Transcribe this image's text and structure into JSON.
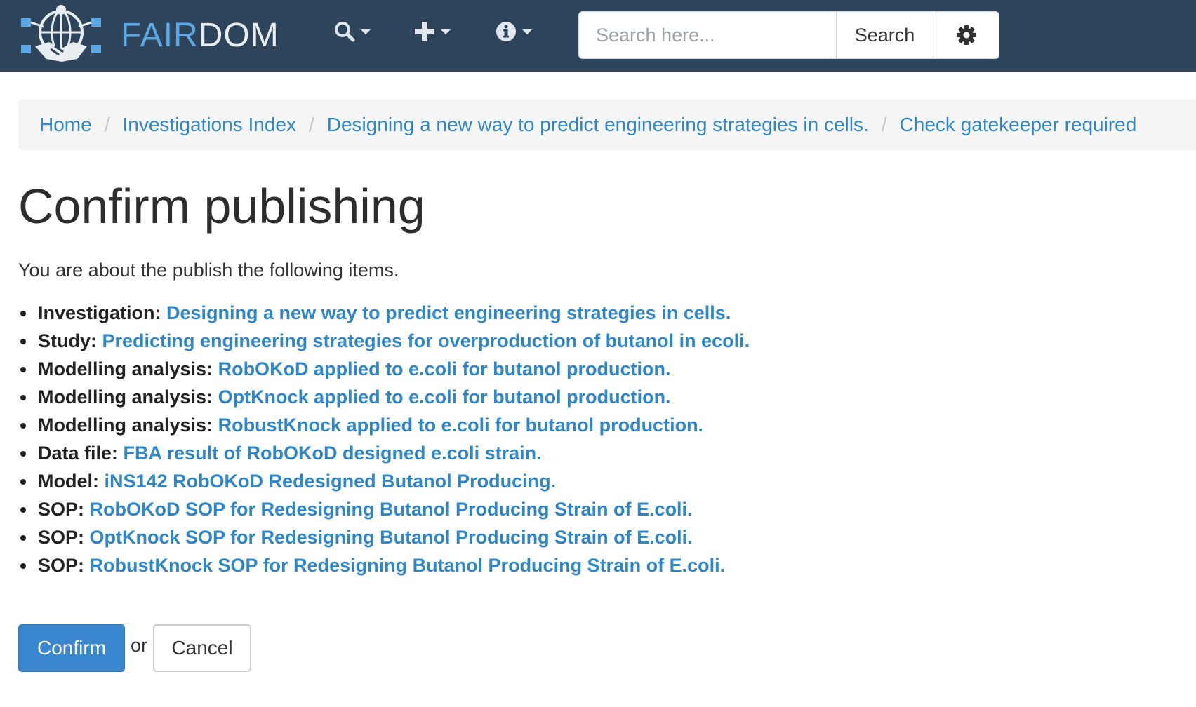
{
  "navbar": {
    "brand_fair": "FAIR",
    "brand_dom": "DOM",
    "menus": [
      {
        "icon": "search-icon"
      },
      {
        "icon": "plus-icon"
      },
      {
        "icon": "info-icon"
      }
    ],
    "search": {
      "placeholder": "Search here...",
      "button_label": "Search"
    },
    "settings_icon": "gear-icon"
  },
  "breadcrumb": [
    "Home",
    "Investigations Index",
    "Designing a new way to predict engineering strategies in cells.",
    "Check gatekeeper required"
  ],
  "breadcrumb_separator": "/",
  "main": {
    "title": "Confirm publishing",
    "intro": "You are about the publish the following items.",
    "items": [
      {
        "type": "Investigation:",
        "title": "Designing a new way to predict engineering strategies in cells."
      },
      {
        "type": "Study:",
        "title": "Predicting engineering strategies for overproduction of butanol in ecoli."
      },
      {
        "type": "Modelling analysis:",
        "title": "RobOKoD applied to e.coli for butanol production."
      },
      {
        "type": "Modelling analysis:",
        "title": "OptKnock applied to e.coli for butanol production."
      },
      {
        "type": "Modelling analysis:",
        "title": "RobustKnock applied to e.coli for butanol production."
      },
      {
        "type": "Data file:",
        "title": "FBA result of RobOKoD designed e.coli strain."
      },
      {
        "type": "Model:",
        "title": "iNS142 RobOKoD Redesigned Butanol Producing."
      },
      {
        "type": "SOP:",
        "title": "RobOKoD SOP for Redesigning Butanol Producing Strain of E.coli."
      },
      {
        "type": "SOP:",
        "title": "OptKnock SOP for Redesigning Butanol Producing Strain of E.coli."
      },
      {
        "type": "SOP:",
        "title": "RobustKnock SOP for Redesigning Butanol Producing Strain of E.coli."
      }
    ],
    "confirm_label": "Confirm",
    "or_text": "or",
    "cancel_label": "Cancel"
  },
  "colors": {
    "navbar_bg": "#2d445a",
    "link": "#2e86c9",
    "primary_button": "#3a87cf",
    "brand_accent": "#5aa9e6"
  }
}
